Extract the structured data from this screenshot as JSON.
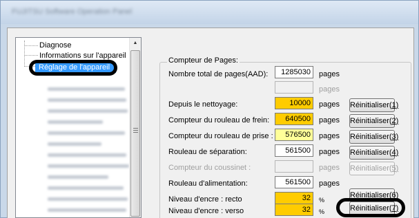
{
  "window": {
    "title": "FUJITSU Software Operation Panel"
  },
  "tree": {
    "items": [
      {
        "label": "Diagnose"
      },
      {
        "label": "Informations sur l'appareil"
      },
      {
        "label": "Réglage de l'appareil",
        "selected": true
      }
    ]
  },
  "group": {
    "title": "Compteur de Pages:"
  },
  "rows": [
    {
      "label": "Nombre total de pages(AAD):",
      "value": "1285030",
      "unit": "pages",
      "highlight": "none",
      "disabled": false
    },
    {
      "label": "",
      "value": "",
      "unit": "pages",
      "highlight": "none",
      "disabled": true
    },
    {
      "label": "Depuis le nettoyage:",
      "value": "10000",
      "unit": "pages",
      "highlight": "yellow",
      "disabled": false,
      "button": {
        "text": "Réinitialiser(",
        "key": "1",
        "close": ")"
      }
    },
    {
      "label": "Compteur du rouleau de frein:",
      "value": "640500",
      "unit": "pages",
      "highlight": "yellow",
      "disabled": false,
      "button": {
        "text": "Réinitialiser(",
        "key": "2",
        "close": ")"
      }
    },
    {
      "label": "Compteur du rouleau de prise :",
      "value": "576500",
      "unit": "pages",
      "highlight": "lightyellow",
      "disabled": false,
      "button": {
        "text": "Réinitialiser(",
        "key": "3",
        "close": ")"
      }
    },
    {
      "label": "Rouleau de séparation:",
      "value": "561500",
      "unit": "pages",
      "highlight": "none",
      "disabled": false,
      "button": {
        "text": "Réinitialiser(",
        "key": "4",
        "close": ")"
      }
    },
    {
      "label": "Compteur du coussinet :",
      "value": "",
      "unit": "pages",
      "highlight": "none",
      "disabled": true,
      "button": {
        "text": "Réinitialiser(",
        "key": "5",
        "close": ")"
      }
    },
    {
      "label": "Rouleau d'alimentation:",
      "value": "561500",
      "unit": "pages",
      "highlight": "none",
      "disabled": false
    },
    {
      "label": "Niveau d'encre : recto",
      "value": "32",
      "unit": "%",
      "highlight": "yellow",
      "disabled": false,
      "button": {
        "text": "Réinitialiser(",
        "key": "6",
        "close": ")"
      }
    },
    {
      "label": "Niveau d'encre : verso",
      "value": "32",
      "unit": "%",
      "highlight": "yellow",
      "disabled": false,
      "button": {
        "text": "Réinitialiser(",
        "key": "7",
        "close": ")"
      }
    }
  ],
  "colors": {
    "selection": "#3399ff",
    "highlight_yellow": "#ffcc00",
    "highlight_light_yellow": "#ffff99",
    "annotation_ring": "#000000"
  }
}
